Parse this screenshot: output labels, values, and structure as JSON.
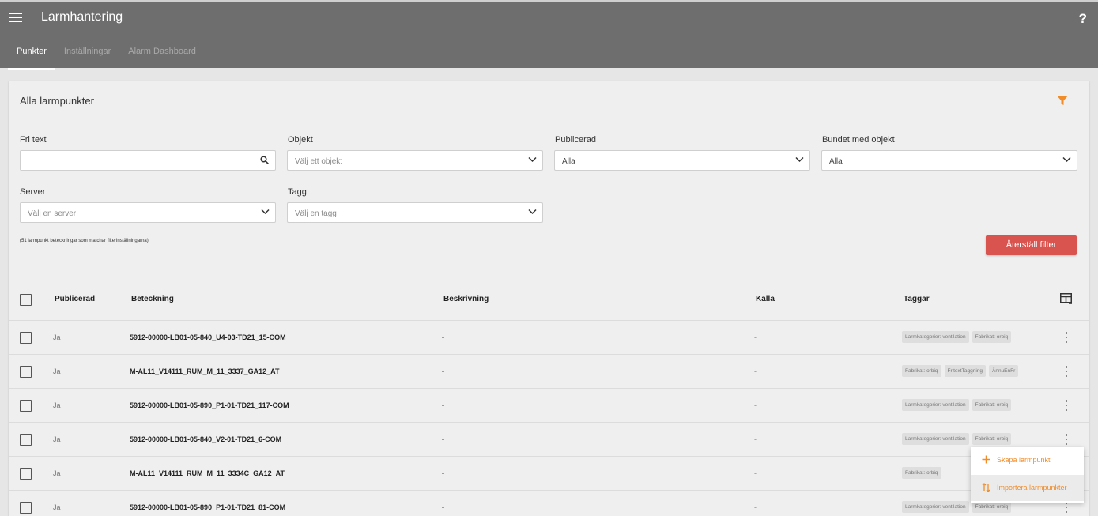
{
  "header": {
    "title": "Larmhantering",
    "help": "?",
    "menu_icon": "hamburger-menu-icon"
  },
  "tabs": [
    {
      "label": "Punkter",
      "active": true
    },
    {
      "label": "Inställningar",
      "active": false
    },
    {
      "label": "Alarm Dashboard",
      "active": false
    }
  ],
  "card": {
    "title": "Alla larmpunkter",
    "filter_icon": "funnel-icon"
  },
  "filters": {
    "fritext": {
      "label": "Fri text",
      "value": ""
    },
    "objekt": {
      "label": "Objekt",
      "placeholder": "Välj ett objekt"
    },
    "publicerad": {
      "label": "Publicerad",
      "value": "Alla"
    },
    "bundet": {
      "label": "Bundet med objekt",
      "value": "Alla"
    },
    "server": {
      "label": "Server",
      "placeholder": "Välj en server"
    },
    "tagg": {
      "label": "Tagg",
      "placeholder": "Välj en tagg"
    }
  },
  "match_text": "(51 larmpunkt beteckningar som matchar filterinställningarna)",
  "reset_label": "Återställ filter",
  "table": {
    "headers": {
      "publicerad": "Publicerad",
      "beteckning": "Beteckning",
      "beskrivning": "Beskrivning",
      "kalla": "Källa",
      "taggar": "Taggar"
    },
    "rows": [
      {
        "publicerad": "Ja",
        "beteckning": "5912-00000-LB01-05-840_U4-03-TD21_15-COM",
        "beskrivning": "-",
        "kalla": "-",
        "tags": [
          "Larmkategorier: ventilation",
          "Fabrikat: orbiq"
        ]
      },
      {
        "publicerad": "Ja",
        "beteckning": "M-AL11_V14111_RUM_M_11_3337_GA12_AT",
        "beskrivning": "-",
        "kalla": "-",
        "tags": [
          "Fabrikat: orbiq",
          "FritextTaggning",
          "ÄnnuEnFr"
        ]
      },
      {
        "publicerad": "Ja",
        "beteckning": "5912-00000-LB01-05-890_P1-01-TD21_117-COM",
        "beskrivning": "-",
        "kalla": "-",
        "tags": [
          "Larmkategorier: ventilation",
          "Fabrikat: orbiq"
        ]
      },
      {
        "publicerad": "Ja",
        "beteckning": "5912-00000-LB01-05-840_V2-01-TD21_6-COM",
        "beskrivning": "-",
        "kalla": "-",
        "tags": [
          "Larmkategorier: ventilation",
          "Fabrikat: orbiq"
        ]
      },
      {
        "publicerad": "Ja",
        "beteckning": "M-AL11_V14111_RUM_M_11_3334C_GA12_AT",
        "beskrivning": "-",
        "kalla": "-",
        "tags": [
          "Fabrikat: orbiq"
        ]
      },
      {
        "publicerad": "Ja",
        "beteckning": "5912-00000-LB01-05-890_P1-01-TD21_81-COM",
        "beskrivning": "-",
        "kalla": "-",
        "tags": [
          "Larmkategorier: ventilation",
          "Fabrikat: orbiq"
        ]
      }
    ]
  },
  "speed_dial": {
    "create": "Skapa larmpunkt",
    "import": "Importera larmpunkter"
  },
  "colors": {
    "accent": "#f28c28",
    "danger": "#d9534f",
    "appbar": "#6e6e6e"
  }
}
